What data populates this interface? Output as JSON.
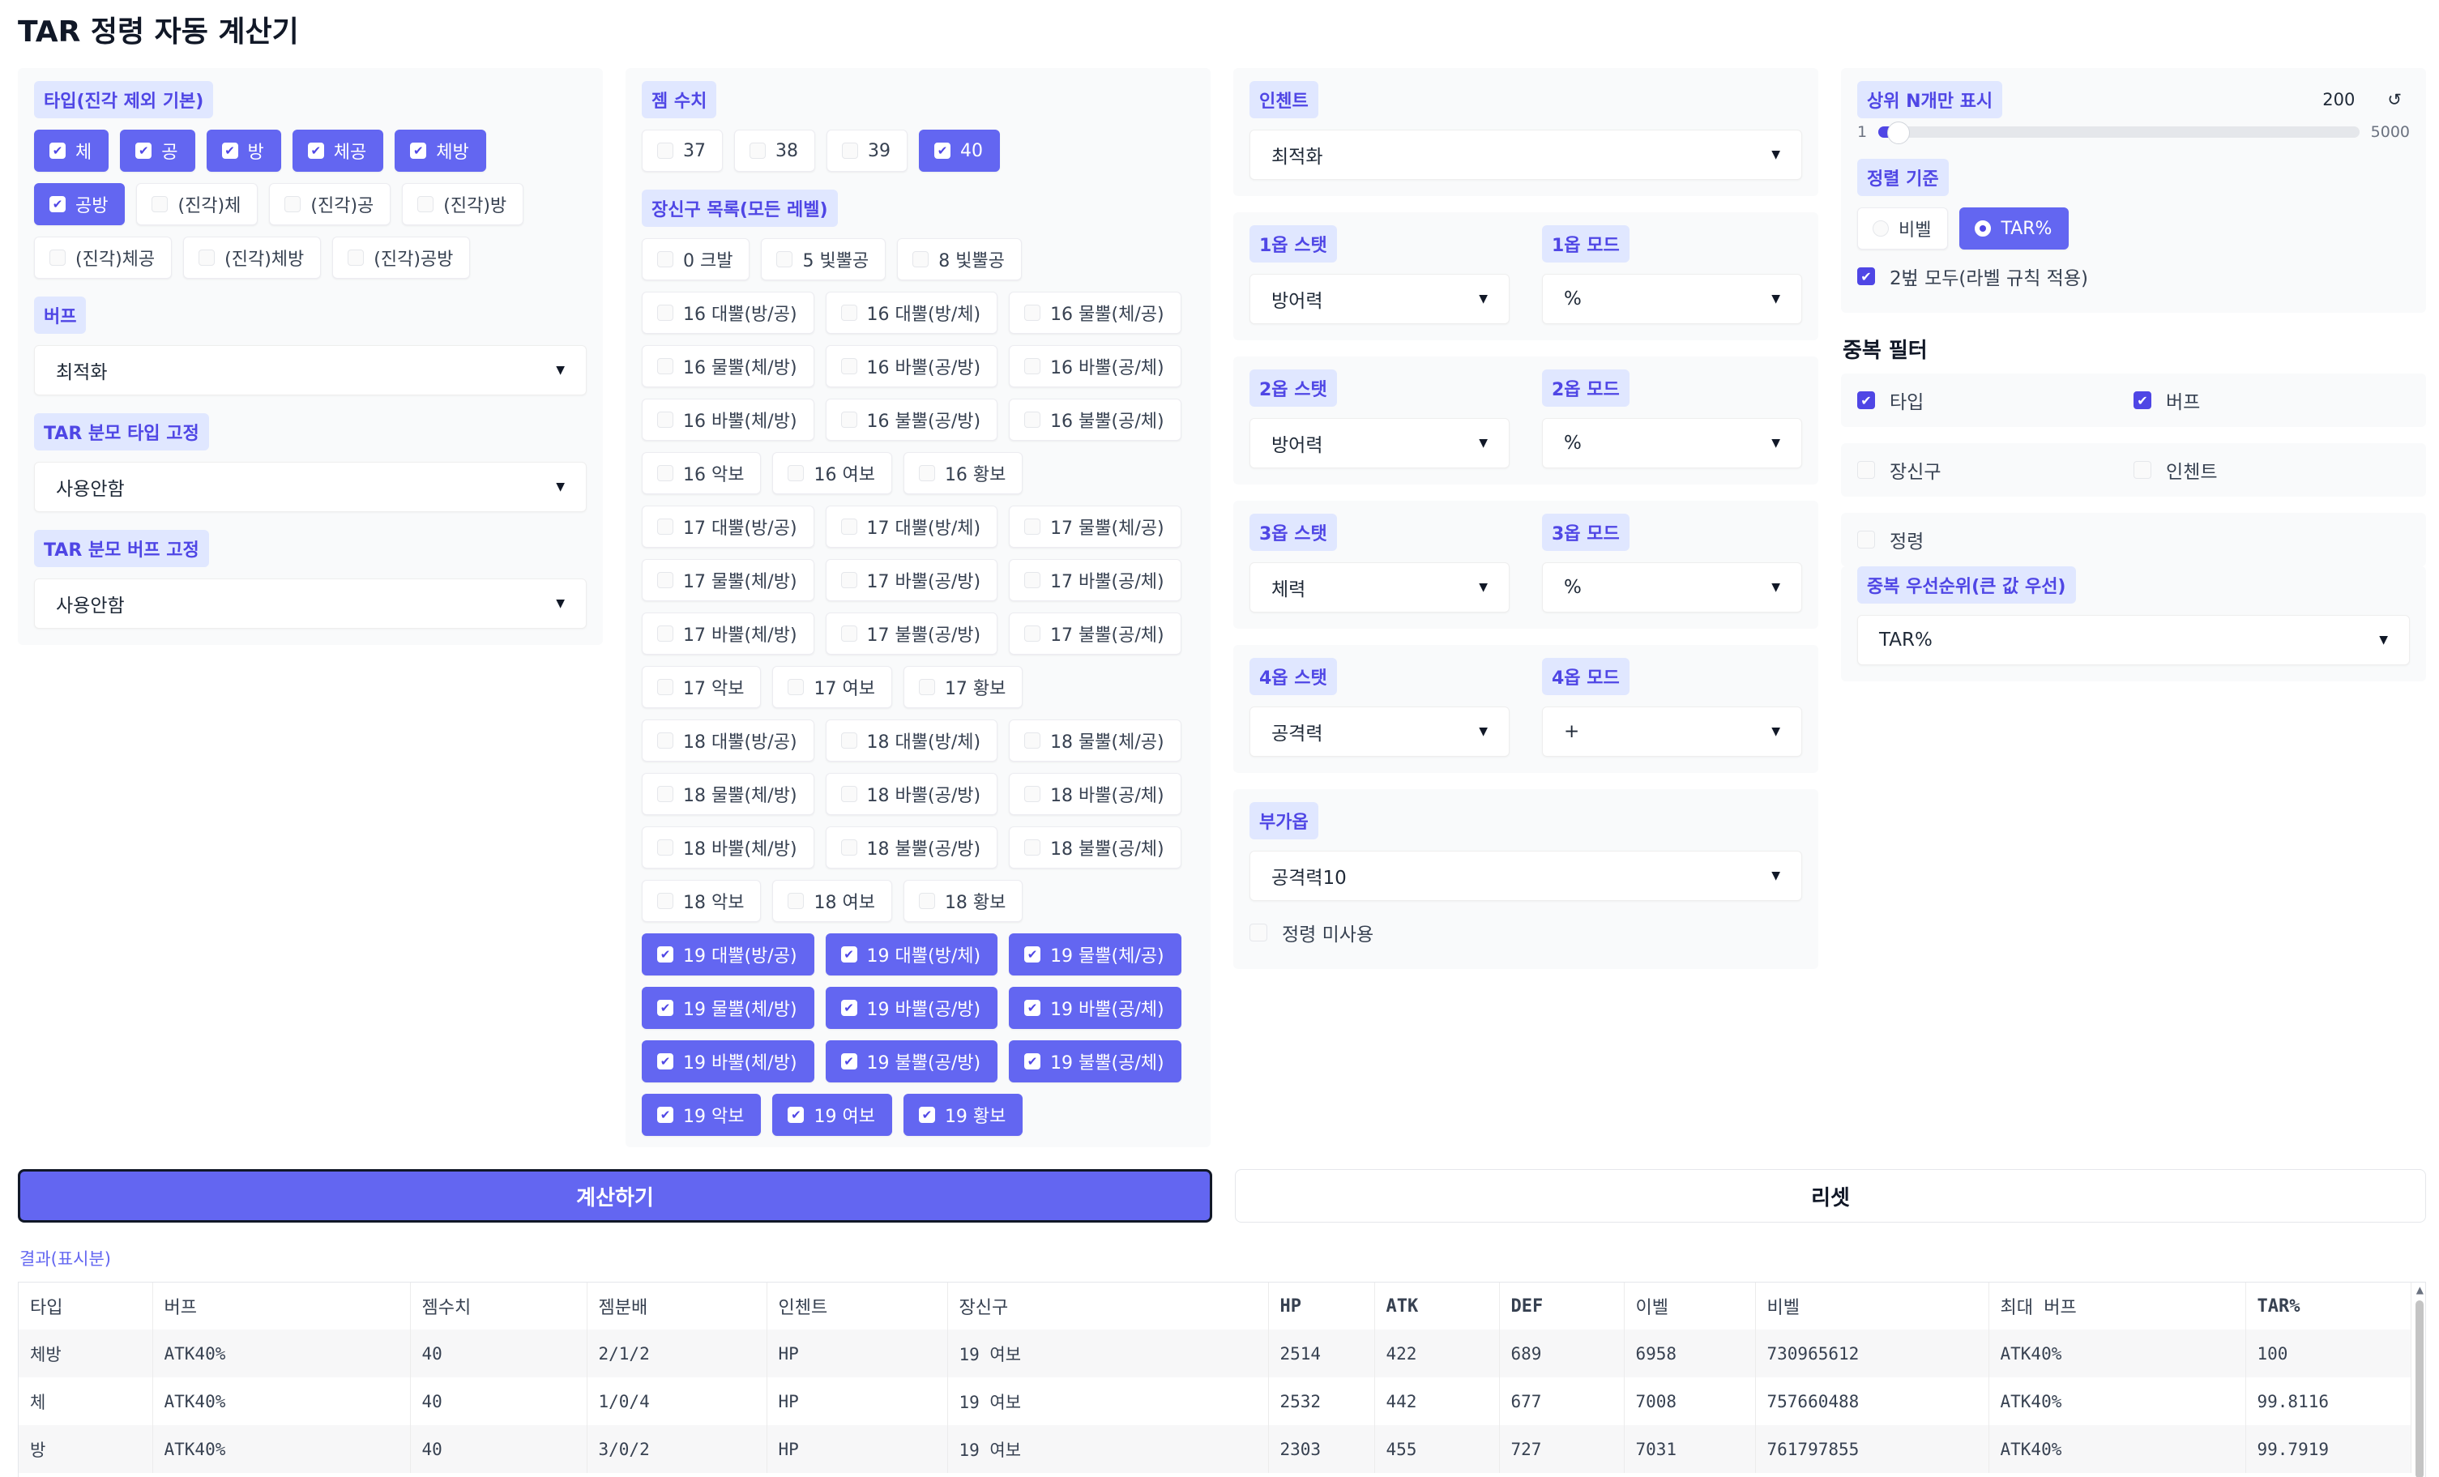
{
  "app": {
    "title": "TAR 정령 자동 계산기"
  },
  "type_panel": {
    "label": "타입(진각 제외 기본)",
    "options": [
      {
        "label": "체",
        "checked": true
      },
      {
        "label": "공",
        "checked": true
      },
      {
        "label": "방",
        "checked": true
      },
      {
        "label": "체공",
        "checked": true
      },
      {
        "label": "체방",
        "checked": true
      },
      {
        "label": "공방",
        "checked": true
      },
      {
        "label": "(진각)체",
        "checked": false
      },
      {
        "label": "(진각)공",
        "checked": false
      },
      {
        "label": "(진각)방",
        "checked": false
      },
      {
        "label": "(진각)체공",
        "checked": false
      },
      {
        "label": "(진각)체방",
        "checked": false
      },
      {
        "label": "(진각)공방",
        "checked": false
      }
    ]
  },
  "buff": {
    "label": "버프",
    "value": "최적화"
  },
  "parent_type": {
    "label": "TAR 분모 타입 고정",
    "value": "사용안함"
  },
  "parent_buff": {
    "label": "TAR 분모 버프 고정",
    "value": "사용안함"
  },
  "gem": {
    "label": "젬 수치",
    "options": [
      {
        "label": "37",
        "checked": false
      },
      {
        "label": "38",
        "checked": false
      },
      {
        "label": "39",
        "checked": false
      },
      {
        "label": "40",
        "checked": true
      }
    ]
  },
  "accessories": {
    "label": "장신구 목록(모든 레벨)",
    "options": [
      {
        "label": "0 크발",
        "checked": false
      },
      {
        "label": "5 빛뿔공",
        "checked": false
      },
      {
        "label": "8 빛뿔공",
        "checked": false
      },
      {
        "label": "16 대뿔(방/공)",
        "checked": false
      },
      {
        "label": "16 대뿔(방/체)",
        "checked": false
      },
      {
        "label": "16 물뿔(체/공)",
        "checked": false
      },
      {
        "label": "16 물뿔(체/방)",
        "checked": false
      },
      {
        "label": "16 바뿔(공/방)",
        "checked": false
      },
      {
        "label": "16 바뿔(공/체)",
        "checked": false
      },
      {
        "label": "16 바뿔(체/방)",
        "checked": false
      },
      {
        "label": "16 불뿔(공/방)",
        "checked": false
      },
      {
        "label": "16 불뿔(공/체)",
        "checked": false
      },
      {
        "label": "16 악보",
        "checked": false
      },
      {
        "label": "16 여보",
        "checked": false
      },
      {
        "label": "16 황보",
        "checked": false
      },
      {
        "label": "17 대뿔(방/공)",
        "checked": false
      },
      {
        "label": "17 대뿔(방/체)",
        "checked": false
      },
      {
        "label": "17 물뿔(체/공)",
        "checked": false
      },
      {
        "label": "17 물뿔(체/방)",
        "checked": false
      },
      {
        "label": "17 바뿔(공/방)",
        "checked": false
      },
      {
        "label": "17 바뿔(공/체)",
        "checked": false
      },
      {
        "label": "17 바뿔(체/방)",
        "checked": false
      },
      {
        "label": "17 불뿔(공/방)",
        "checked": false
      },
      {
        "label": "17 불뿔(공/체)",
        "checked": false
      },
      {
        "label": "17 악보",
        "checked": false
      },
      {
        "label": "17 여보",
        "checked": false
      },
      {
        "label": "17 황보",
        "checked": false
      },
      {
        "label": "18 대뿔(방/공)",
        "checked": false
      },
      {
        "label": "18 대뿔(방/체)",
        "checked": false
      },
      {
        "label": "18 물뿔(체/공)",
        "checked": false
      },
      {
        "label": "18 물뿔(체/방)",
        "checked": false
      },
      {
        "label": "18 바뿔(공/방)",
        "checked": false
      },
      {
        "label": "18 바뿔(공/체)",
        "checked": false
      },
      {
        "label": "18 바뿔(체/방)",
        "checked": false
      },
      {
        "label": "18 불뿔(공/방)",
        "checked": false
      },
      {
        "label": "18 불뿔(공/체)",
        "checked": false
      },
      {
        "label": "18 악보",
        "checked": false
      },
      {
        "label": "18 여보",
        "checked": false
      },
      {
        "label": "18 황보",
        "checked": false
      },
      {
        "label": "19 대뿔(방/공)",
        "checked": true
      },
      {
        "label": "19 대뿔(방/체)",
        "checked": true
      },
      {
        "label": "19 물뿔(체/공)",
        "checked": true
      },
      {
        "label": "19 물뿔(체/방)",
        "checked": true
      },
      {
        "label": "19 바뿔(공/방)",
        "checked": true
      },
      {
        "label": "19 바뿔(공/체)",
        "checked": true
      },
      {
        "label": "19 바뿔(체/방)",
        "checked": true
      },
      {
        "label": "19 불뿔(공/방)",
        "checked": true
      },
      {
        "label": "19 불뿔(공/체)",
        "checked": true
      },
      {
        "label": "19 악보",
        "checked": true
      },
      {
        "label": "19 여보",
        "checked": true
      },
      {
        "label": "19 황보",
        "checked": true
      }
    ]
  },
  "enchant": {
    "label": "인첸트",
    "value": "최적화"
  },
  "stats": [
    {
      "stat_label": "1옵 스탯",
      "stat_value": "방어력",
      "mode_label": "1옵 모드",
      "mode_value": "%"
    },
    {
      "stat_label": "2옵 스탯",
      "stat_value": "방어력",
      "mode_label": "2옵 모드",
      "mode_value": "%"
    },
    {
      "stat_label": "3옵 스탯",
      "stat_value": "체력",
      "mode_label": "3옵 모드",
      "mode_value": "%"
    },
    {
      "stat_label": "4옵 스탯",
      "stat_value": "공격력",
      "mode_label": "4옵 모드",
      "mode_value": "+"
    }
  ],
  "extra": {
    "label": "부가옵",
    "value": "공격력10",
    "no_spirit_label": "정령 미사용",
    "no_spirit_checked": false
  },
  "topn": {
    "label": "상위 N개만 표시",
    "value": "200",
    "reset_icon": "↺",
    "min": "1",
    "max": "5000",
    "fraction": 0.04
  },
  "sort": {
    "label": "정렬 기준",
    "options": [
      {
        "label": "비벨",
        "checked": false
      },
      {
        "label": "TAR%",
        "checked": true
      }
    ],
    "both_label": "2벞 모두(라벨 규칙 적용)",
    "both_checked": true
  },
  "dup": {
    "title": "중복 필터",
    "rows": [
      [
        {
          "label": "타입",
          "checked": true
        },
        {
          "label": "버프",
          "checked": true
        }
      ],
      [
        {
          "label": "장신구",
          "checked": false
        },
        {
          "label": "인첸트",
          "checked": false
        }
      ],
      [
        {
          "label": "정령",
          "checked": false
        }
      ]
    ],
    "priority_label": "중복 우선순위(큰 값 우선)",
    "priority_value": "TAR%"
  },
  "actions": {
    "calc_label": "계산하기",
    "reset_label": "리셋"
  },
  "results": {
    "label": "결과(표시분)",
    "columns": [
      "타입",
      "버프",
      "젬수치",
      "젬분배",
      "인첸트",
      "장신구",
      "HP",
      "ATK",
      "DEF",
      "이벨",
      "비벨",
      "최대 버프",
      "TAR%"
    ],
    "rows": [
      [
        "체방",
        "ATK40%",
        "40",
        "2/1/2",
        "HP",
        "19 여보",
        "2514",
        "422",
        "689",
        "6958",
        "730965612",
        "ATK40%",
        "100"
      ],
      [
        "체",
        "ATK40%",
        "40",
        "1/0/4",
        "HP",
        "19 여보",
        "2532",
        "442",
        "677",
        "7008",
        "757660488",
        "ATK40%",
        "99.8116"
      ],
      [
        "방",
        "ATK40%",
        "40",
        "3/0/2",
        "HP",
        "19 여보",
        "2303",
        "455",
        "727",
        "7031",
        "761797855",
        "ATK40%",
        "99.7919"
      ]
    ]
  }
}
